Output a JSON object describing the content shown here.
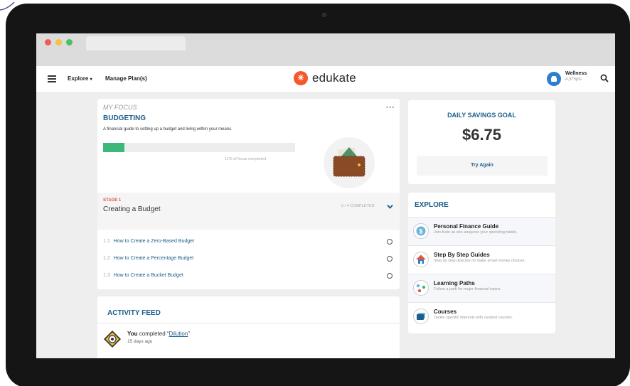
{
  "header": {
    "nav_explore": "Explore",
    "nav_manage": "Manage Plan(s)",
    "logo_text": "edukate",
    "user_name": "Wellness",
    "user_points": "4,375pts"
  },
  "focus": {
    "label": "MY FOCUS",
    "more": "•••",
    "title": "BUDGETING",
    "description": "A financial guide to setting up a budget and living within your means.",
    "progress_percent": 11,
    "progress_text": "11% of focus completed"
  },
  "stage": {
    "label": "STAGE 1",
    "title": "Creating a Budget",
    "progress": "0 / 4 COMPLETED",
    "lessons": [
      {
        "num": "1.1",
        "title": "How to Create a Zero-Based Budget"
      },
      {
        "num": "1.2",
        "title": "How to Create a Percentage Budget"
      },
      {
        "num": "1.3",
        "title": "How to Create a Bucket Budget"
      }
    ]
  },
  "feed": {
    "title": "ACTIVITY FEED",
    "actor": "You",
    "action": " completed “",
    "item": "Dilution",
    "close": "”",
    "time": "15 days ago"
  },
  "savings": {
    "title": "DAILY SAVINGS GOAL",
    "amount": "$6.75",
    "button": "Try Again"
  },
  "explore": {
    "title": "EXPLORE",
    "items": [
      {
        "name": "Personal Finance Guide",
        "desc": "Join Kate as she analyzes your spending habits.",
        "icon": "dollar-icon"
      },
      {
        "name": "Step By Step Guides",
        "desc": "Step by step direction to make smart money choices.",
        "icon": "house-icon"
      },
      {
        "name": "Learning Paths",
        "desc": "Follow a path for major financial topics.",
        "icon": "path-icon"
      },
      {
        "name": "Courses",
        "desc": "Tackle specific interests with curated courses.",
        "icon": "courses-icon"
      }
    ]
  },
  "colors": {
    "accent": "#1c5e8a",
    "brand": "#f4572a",
    "progress": "#3cb878",
    "stage_label": "#e2553d"
  }
}
